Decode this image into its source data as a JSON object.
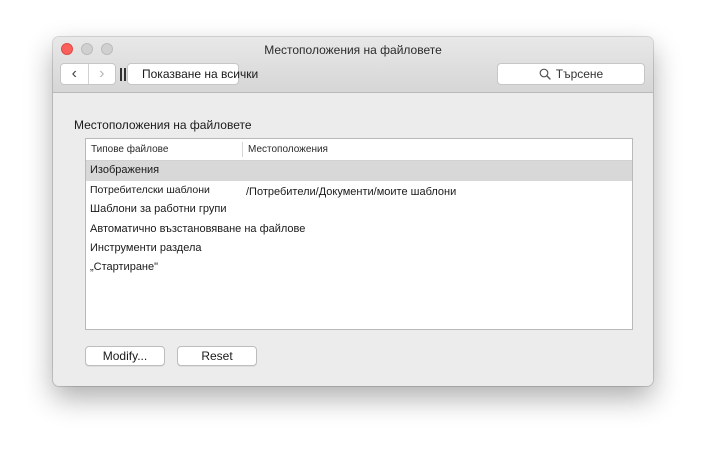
{
  "window": {
    "title": "Местоположения на файловете"
  },
  "toolbar": {
    "back_icon": "‹",
    "forward_icon": "›",
    "show_all_label": "Показване на всички",
    "search_placeholder": "Търсене"
  },
  "section": {
    "title": "Местоположения на файловете"
  },
  "table": {
    "columns": [
      "Типове файлове",
      "Местоположения"
    ],
    "rows": [
      {
        "type": "Изображения",
        "location": ""
      },
      {
        "type": "Потребителски шаблони",
        "location": "/Потребители/Документи/моите шаблони"
      },
      {
        "type": "Шаблони за работни групи",
        "location": ""
      },
      {
        "type": "Автоматично възстановяване на файлове",
        "location": ""
      },
      {
        "type": "Инструменти раздела „Стартиране\"",
        "location": ""
      }
    ]
  },
  "buttons": {
    "modify_label": "Modify...",
    "reset_label": "Reset"
  },
  "colors": {
    "close": "#fc605c",
    "selected_row": "#d8d8d8",
    "window_bg": "#ececec"
  }
}
